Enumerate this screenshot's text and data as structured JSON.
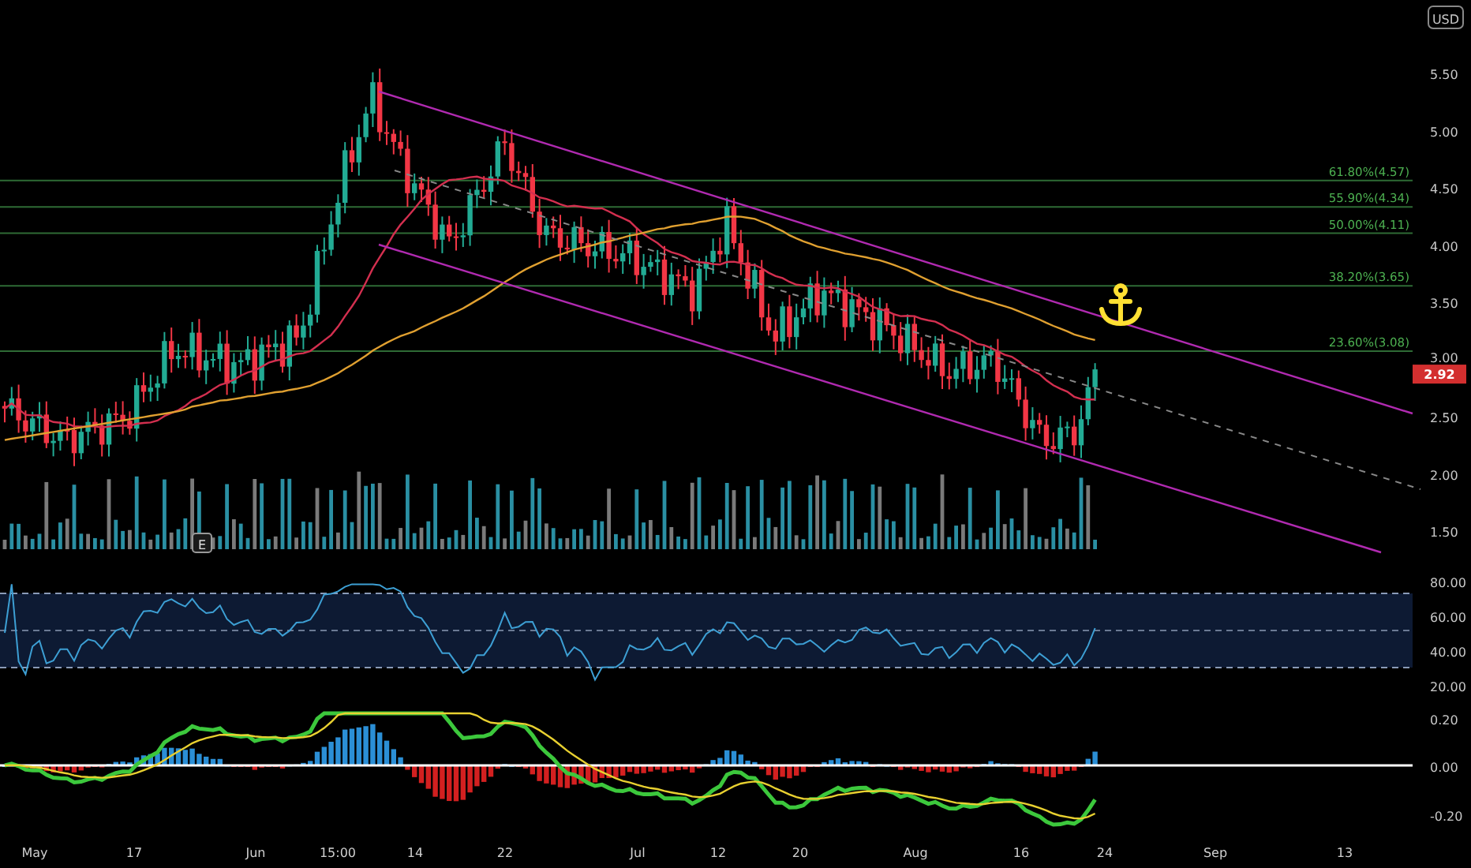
{
  "currency_button": "USD",
  "price_axis": [
    "5.50",
    "5.00",
    "4.50",
    "4.00",
    "3.50",
    "3.00",
    "2.50",
    "2.00",
    "1.50"
  ],
  "last_price": "2.92",
  "fib_levels": [
    {
      "label": "61.80%(4.57)"
    },
    {
      "label": "55.90%(4.34)"
    },
    {
      "label": "50.00%(4.11)"
    },
    {
      "label": "38.20%(3.65)"
    },
    {
      "label": "23.60%(3.08)"
    }
  ],
  "earnings_marker": "E",
  "rsi_axis": [
    "80.00",
    "60.00",
    "40.00",
    "20.00"
  ],
  "macd_axis": [
    "0.20",
    "0.00",
    "-0.20"
  ],
  "time_axis": [
    "May",
    "17",
    "Jun",
    "15:00",
    "14",
    "22",
    "Jul",
    "12",
    "20",
    "Aug",
    "16",
    "24",
    "Sep",
    "13"
  ]
}
